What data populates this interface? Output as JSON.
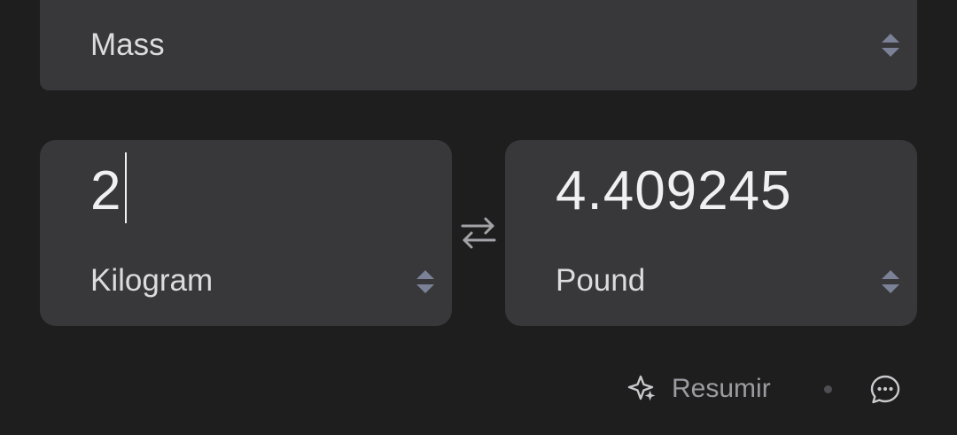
{
  "category": {
    "selected": "Mass"
  },
  "from": {
    "value": "2",
    "unit": "Kilogram"
  },
  "to": {
    "value": "4.409245",
    "unit": "Pound"
  },
  "footer": {
    "summarize_label": "Resumir"
  },
  "icons": {
    "spinner": "updown-chevron-icon",
    "swap": "swap-arrows-icon",
    "summarize": "sparkle-icon",
    "feedback": "chat-bubble-icon"
  },
  "colors": {
    "background": "#1e1e1f",
    "panel": "#38383b",
    "spinner": "#7b8196",
    "muted_text": "#9c9ca0"
  }
}
